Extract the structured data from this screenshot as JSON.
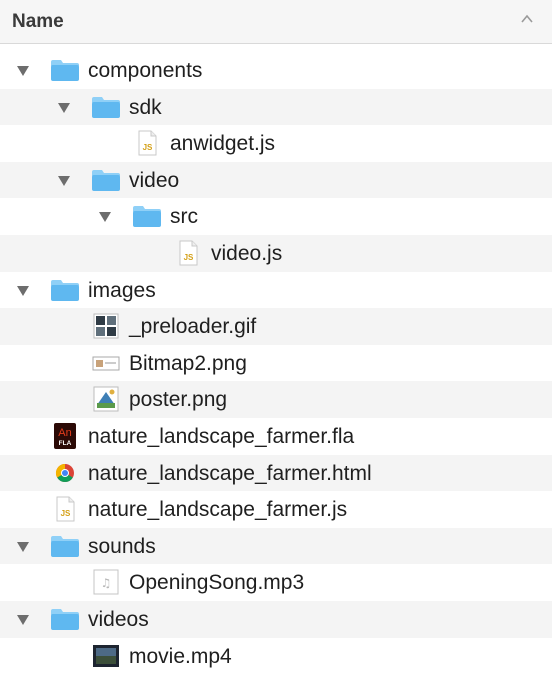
{
  "header": {
    "name_label": "Name"
  },
  "rows": [
    {
      "label": "components",
      "type": "folder",
      "depth": 0,
      "expanded": true
    },
    {
      "label": "sdk",
      "type": "folder",
      "depth": 1,
      "expanded": true
    },
    {
      "label": "anwidget.js",
      "type": "js-file",
      "depth": 2
    },
    {
      "label": "video",
      "type": "folder",
      "depth": 1,
      "expanded": true
    },
    {
      "label": "src",
      "type": "folder",
      "depth": 2,
      "expanded": true
    },
    {
      "label": "video.js",
      "type": "js-file",
      "depth": 3
    },
    {
      "label": "images",
      "type": "folder",
      "depth": 0,
      "expanded": true
    },
    {
      "label": "_preloader.gif",
      "type": "gif-file",
      "depth": 1
    },
    {
      "label": "Bitmap2.png",
      "type": "bitmap-file",
      "depth": 1
    },
    {
      "label": "poster.png",
      "type": "poster-file",
      "depth": 1
    },
    {
      "label": "nature_landscape_farmer.fla",
      "type": "fla-file",
      "depth": 0
    },
    {
      "label": "nature_landscape_farmer.html",
      "type": "html-file",
      "depth": 0
    },
    {
      "label": "nature_landscape_farmer.js",
      "type": "js-file",
      "depth": 0
    },
    {
      "label": "sounds",
      "type": "folder",
      "depth": 0,
      "expanded": true
    },
    {
      "label": "OpeningSong.mp3",
      "type": "audio-file",
      "depth": 1
    },
    {
      "label": "videos",
      "type": "folder",
      "depth": 0,
      "expanded": true
    },
    {
      "label": "movie.mp4",
      "type": "video-file",
      "depth": 1
    }
  ],
  "icons": {
    "js_badge": "JS",
    "fla_badge_top": "An",
    "fla_badge_bottom": "FLA",
    "audio_glyph": "♫"
  },
  "colors": {
    "folder_blue": "#5fb8f0",
    "folder_tab": "#8fd0f7",
    "js_yellow": "#d4a017",
    "fla_red": "#e23d1c",
    "stripe": "#f4f4f4"
  }
}
